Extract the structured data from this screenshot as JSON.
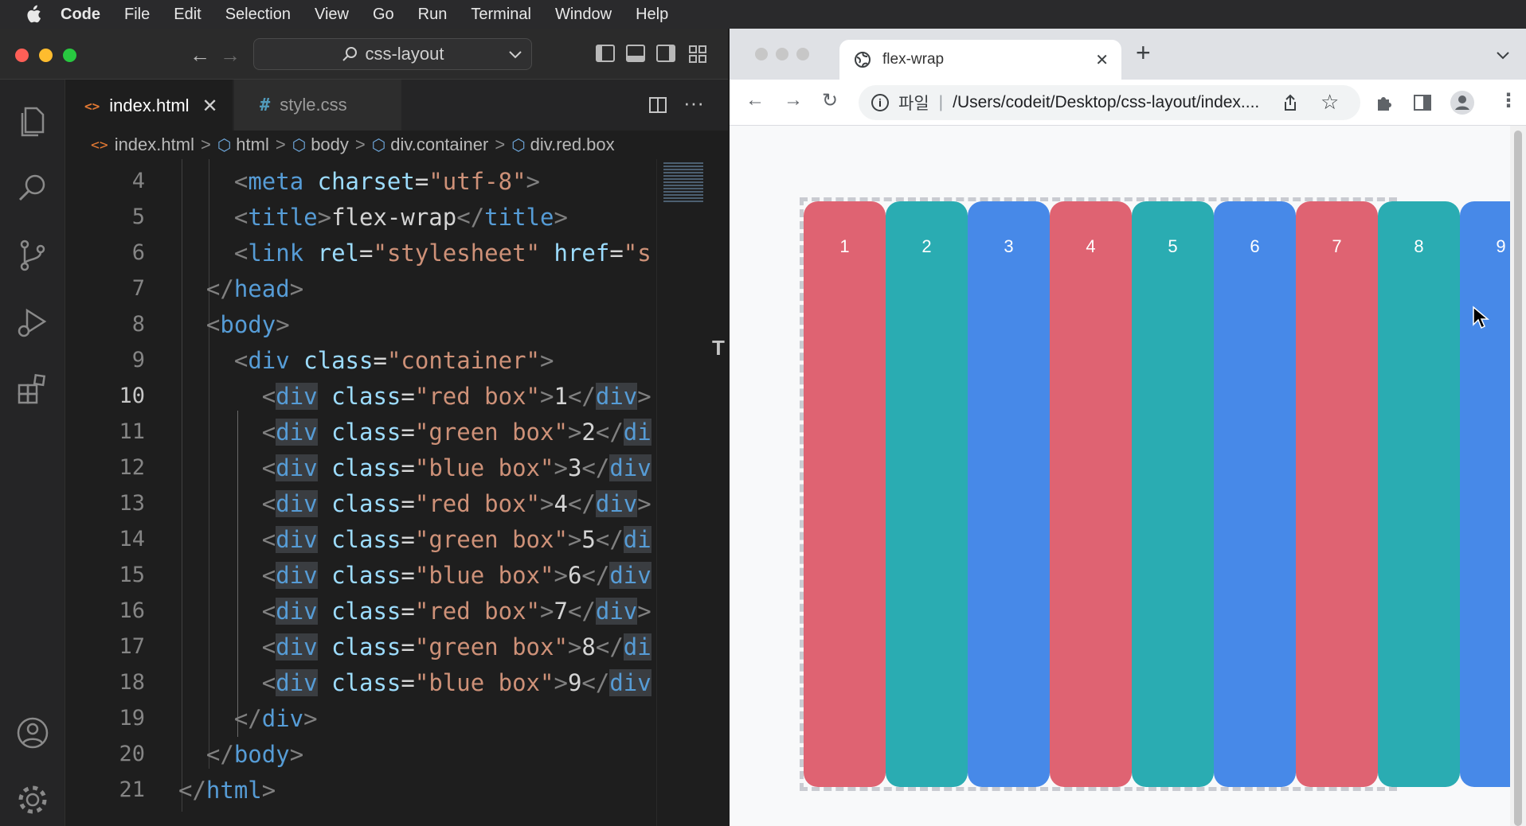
{
  "menubar": {
    "app_name": "Code",
    "items": [
      "File",
      "Edit",
      "Selection",
      "View",
      "Go",
      "Run",
      "Terminal",
      "Window",
      "Help"
    ]
  },
  "vscode": {
    "search_label": "css-layout",
    "tabs": [
      {
        "label": "index.html",
        "icon": "<>",
        "active": true
      },
      {
        "label": "style.css",
        "icon": "#",
        "active": false
      }
    ],
    "breadcrumb": [
      "index.html",
      "html",
      "body",
      "div.container",
      "div.red.box"
    ],
    "code_lines": [
      {
        "n": "4",
        "tokens": [
          [
            "ind",
            "    "
          ],
          [
            "br",
            "<"
          ],
          [
            "tag",
            "meta"
          ],
          [
            "txt",
            " "
          ],
          [
            "attr",
            "charset"
          ],
          [
            "txt",
            "="
          ],
          [
            "str",
            "\"utf-8\""
          ],
          [
            "br",
            ">"
          ]
        ]
      },
      {
        "n": "5",
        "tokens": [
          [
            "ind",
            "    "
          ],
          [
            "br",
            "<"
          ],
          [
            "tag",
            "title"
          ],
          [
            "br",
            ">"
          ],
          [
            "txt",
            "flex-wrap"
          ],
          [
            "br",
            "</"
          ],
          [
            "tag",
            "title"
          ],
          [
            "br",
            ">"
          ]
        ]
      },
      {
        "n": "6",
        "tokens": [
          [
            "ind",
            "    "
          ],
          [
            "br",
            "<"
          ],
          [
            "tag",
            "link"
          ],
          [
            "txt",
            " "
          ],
          [
            "attr",
            "rel"
          ],
          [
            "txt",
            "="
          ],
          [
            "str",
            "\"stylesheet\""
          ],
          [
            "txt",
            " "
          ],
          [
            "attr",
            "href"
          ],
          [
            "txt",
            "="
          ],
          [
            "str",
            "\"s"
          ]
        ]
      },
      {
        "n": "7",
        "tokens": [
          [
            "ind",
            "  "
          ],
          [
            "br",
            "</"
          ],
          [
            "tag",
            "head"
          ],
          [
            "br",
            ">"
          ]
        ]
      },
      {
        "n": "8",
        "tokens": [
          [
            "ind",
            "  "
          ],
          [
            "br",
            "<"
          ],
          [
            "tag",
            "body"
          ],
          [
            "br",
            ">"
          ]
        ]
      },
      {
        "n": "9",
        "tokens": [
          [
            "ind",
            "    "
          ],
          [
            "br",
            "<"
          ],
          [
            "tag",
            "div"
          ],
          [
            "txt",
            " "
          ],
          [
            "attr",
            "class"
          ],
          [
            "txt",
            "="
          ],
          [
            "str",
            "\"container\""
          ],
          [
            "br",
            ">"
          ]
        ]
      },
      {
        "n": "10",
        "tokens": [
          [
            "ind",
            "      "
          ],
          [
            "br",
            "<"
          ],
          [
            "tagh",
            "div"
          ],
          [
            "txt",
            " "
          ],
          [
            "attr",
            "class"
          ],
          [
            "txt",
            "="
          ],
          [
            "str",
            "\"red box\""
          ],
          [
            "br",
            ">"
          ],
          [
            "txt",
            "1"
          ],
          [
            "br",
            "</"
          ],
          [
            "tagh",
            "div"
          ],
          [
            "br",
            ">"
          ]
        ]
      },
      {
        "n": "11",
        "tokens": [
          [
            "ind",
            "      "
          ],
          [
            "br",
            "<"
          ],
          [
            "tagh",
            "div"
          ],
          [
            "txt",
            " "
          ],
          [
            "attr",
            "class"
          ],
          [
            "txt",
            "="
          ],
          [
            "str",
            "\"green box\""
          ],
          [
            "br",
            ">"
          ],
          [
            "txt",
            "2"
          ],
          [
            "br",
            "</"
          ],
          [
            "tagh",
            "di"
          ]
        ]
      },
      {
        "n": "12",
        "tokens": [
          [
            "ind",
            "      "
          ],
          [
            "br",
            "<"
          ],
          [
            "tagh",
            "div"
          ],
          [
            "txt",
            " "
          ],
          [
            "attr",
            "class"
          ],
          [
            "txt",
            "="
          ],
          [
            "str",
            "\"blue box\""
          ],
          [
            "br",
            ">"
          ],
          [
            "txt",
            "3"
          ],
          [
            "br",
            "</"
          ],
          [
            "tagh",
            "div"
          ]
        ]
      },
      {
        "n": "13",
        "tokens": [
          [
            "ind",
            "      "
          ],
          [
            "br",
            "<"
          ],
          [
            "tagh",
            "div"
          ],
          [
            "txt",
            " "
          ],
          [
            "attr",
            "class"
          ],
          [
            "txt",
            "="
          ],
          [
            "str",
            "\"red box\""
          ],
          [
            "br",
            ">"
          ],
          [
            "txt",
            "4"
          ],
          [
            "br",
            "</"
          ],
          [
            "tagh",
            "div"
          ],
          [
            "br",
            ">"
          ]
        ]
      },
      {
        "n": "14",
        "tokens": [
          [
            "ind",
            "      "
          ],
          [
            "br",
            "<"
          ],
          [
            "tagh",
            "div"
          ],
          [
            "txt",
            " "
          ],
          [
            "attr",
            "class"
          ],
          [
            "txt",
            "="
          ],
          [
            "str",
            "\"green box\""
          ],
          [
            "br",
            ">"
          ],
          [
            "txt",
            "5"
          ],
          [
            "br",
            "</"
          ],
          [
            "tagh",
            "di"
          ]
        ]
      },
      {
        "n": "15",
        "tokens": [
          [
            "ind",
            "      "
          ],
          [
            "br",
            "<"
          ],
          [
            "tagh",
            "div"
          ],
          [
            "txt",
            " "
          ],
          [
            "attr",
            "class"
          ],
          [
            "txt",
            "="
          ],
          [
            "str",
            "\"blue box\""
          ],
          [
            "br",
            ">"
          ],
          [
            "txt",
            "6"
          ],
          [
            "br",
            "</"
          ],
          [
            "tagh",
            "div"
          ]
        ]
      },
      {
        "n": "16",
        "tokens": [
          [
            "ind",
            "      "
          ],
          [
            "br",
            "<"
          ],
          [
            "tagh",
            "div"
          ],
          [
            "txt",
            " "
          ],
          [
            "attr",
            "class"
          ],
          [
            "txt",
            "="
          ],
          [
            "str",
            "\"red box\""
          ],
          [
            "br",
            ">"
          ],
          [
            "txt",
            "7"
          ],
          [
            "br",
            "</"
          ],
          [
            "tagh",
            "div"
          ],
          [
            "br",
            ">"
          ]
        ]
      },
      {
        "n": "17",
        "tokens": [
          [
            "ind",
            "      "
          ],
          [
            "br",
            "<"
          ],
          [
            "tagh",
            "div"
          ],
          [
            "txt",
            " "
          ],
          [
            "attr",
            "class"
          ],
          [
            "txt",
            "="
          ],
          [
            "str",
            "\"green box\""
          ],
          [
            "br",
            ">"
          ],
          [
            "txt",
            "8"
          ],
          [
            "br",
            "</"
          ],
          [
            "tagh",
            "di"
          ]
        ]
      },
      {
        "n": "18",
        "tokens": [
          [
            "ind",
            "      "
          ],
          [
            "br",
            "<"
          ],
          [
            "tagh",
            "div"
          ],
          [
            "txt",
            " "
          ],
          [
            "attr",
            "class"
          ],
          [
            "txt",
            "="
          ],
          [
            "str",
            "\"blue box\""
          ],
          [
            "br",
            ">"
          ],
          [
            "txt",
            "9"
          ],
          [
            "br",
            "</"
          ],
          [
            "tagh",
            "div"
          ]
        ]
      },
      {
        "n": "19",
        "tokens": [
          [
            "ind",
            "    "
          ],
          [
            "br",
            "</"
          ],
          [
            "tag",
            "div"
          ],
          [
            "br",
            ">"
          ]
        ]
      },
      {
        "n": "20",
        "tokens": [
          [
            "ind",
            "  "
          ],
          [
            "br",
            "</"
          ],
          [
            "tag",
            "body"
          ],
          [
            "br",
            ">"
          ]
        ]
      },
      {
        "n": "21",
        "tokens": [
          [
            "br",
            "</"
          ],
          [
            "tag",
            "html"
          ],
          [
            "br",
            ">"
          ]
        ]
      }
    ],
    "current_line": "10"
  },
  "chrome": {
    "tab_title": "flex-wrap",
    "address_scheme": "파일",
    "address_url": "/Users/codeit/Desktop/css-layout/index....",
    "boxes": [
      {
        "label": "1",
        "color": "red"
      },
      {
        "label": "2",
        "color": "green"
      },
      {
        "label": "3",
        "color": "blue"
      },
      {
        "label": "4",
        "color": "red"
      },
      {
        "label": "5",
        "color": "green"
      },
      {
        "label": "6",
        "color": "blue"
      },
      {
        "label": "7",
        "color": "red"
      },
      {
        "label": "8",
        "color": "green"
      },
      {
        "label": "9",
        "color": "blue"
      }
    ]
  },
  "colors": {
    "red_box": "#df6372",
    "green_box": "#2aacb2",
    "blue_box": "#4789e8",
    "traffic_red": "#fe5f57",
    "traffic_yellow": "#febc2e",
    "traffic_green": "#28c840"
  }
}
